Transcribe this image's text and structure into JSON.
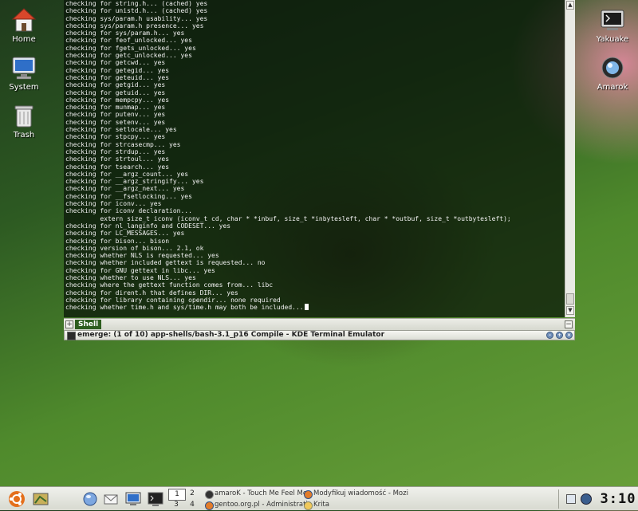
{
  "desktop": {
    "icons_left": [
      {
        "label": "Home",
        "icon": "home-icon"
      },
      {
        "label": "System",
        "icon": "monitor-icon"
      },
      {
        "label": "Trash",
        "icon": "trash-icon"
      }
    ],
    "icons_right": [
      {
        "label": "Yakuake",
        "icon": "terminal-icon"
      },
      {
        "label": "Amarok",
        "icon": "amarok-icon"
      }
    ]
  },
  "terminal": {
    "lines": [
      "checking for string.h... (cached) yes",
      "checking for unistd.h... (cached) yes",
      "checking sys/param.h usability... yes",
      "checking sys/param.h presence... yes",
      "checking for sys/param.h... yes",
      "checking for feof_unlocked... yes",
      "checking for fgets_unlocked... yes",
      "checking for getc_unlocked... yes",
      "checking for getcwd... yes",
      "checking for getegid... yes",
      "checking for geteuid... yes",
      "checking for getgid... yes",
      "checking for getuid... yes",
      "checking for mempcpy... yes",
      "checking for munmap... yes",
      "checking for putenv... yes",
      "checking for setenv... yes",
      "checking for setlocale... yes",
      "checking for stpcpy... yes",
      "checking for strcasecmp... yes",
      "checking for strdup... yes",
      "checking for strtoul... yes",
      "checking for tsearch... yes",
      "checking for __argz_count... yes",
      "checking for __argz_stringify... yes",
      "checking for __argz_next... yes",
      "checking for __fsetlocking... yes",
      "checking for iconv... yes",
      "checking for iconv declaration...",
      "         extern size_t iconv (iconv_t cd, char * *inbuf, size_t *inbytesleft, char * *outbuf, size_t *outbytesleft);",
      "checking for nl_langinfo and CODESET... yes",
      "checking for LC_MESSAGES... yes",
      "checking for bison... bison",
      "checking version of bison... 2.1, ok",
      "checking whether NLS is requested... yes",
      "checking whether included gettext is requested... no",
      "checking for GNU gettext in libc... yes",
      "checking whether to use NLS... yes",
      "checking where the gettext function comes from... libc",
      "checking for dirent.h that defines DIR... yes",
      "checking for library containing opendir... none required"
    ],
    "last_line": "checking whether time.h and sys/time.h may both be included...",
    "tab_label": "Shell",
    "window_title": "emerge: (1 of 10) app-shells/bash-3.1_p16 Compile - KDE Terminal Emulator"
  },
  "taskbar": {
    "launchers": [
      "ubuntu-menu-icon",
      "show-desktop-icon",
      "browser-globe-icon",
      "mail-icon",
      "system-monitor-icon",
      "terminal-icon"
    ],
    "pager": [
      "1",
      "2",
      "3",
      "4"
    ],
    "tasks": [
      {
        "label": "amaroK - Touch Me Feel Me",
        "icon": "amarok-task-icon"
      },
      {
        "label": "Modyfikuj wiadomość - Mozi",
        "icon": "firefox-task-icon"
      },
      {
        "label": "gentoo.org.pl - Administrati",
        "icon": "firefox-task-icon"
      },
      {
        "label": "Krita",
        "icon": "krita-task-icon"
      }
    ],
    "clock": "3:10"
  },
  "colors": {
    "shell_tab": "#2d5d1e",
    "titlebar_button": "#6e8db8"
  }
}
